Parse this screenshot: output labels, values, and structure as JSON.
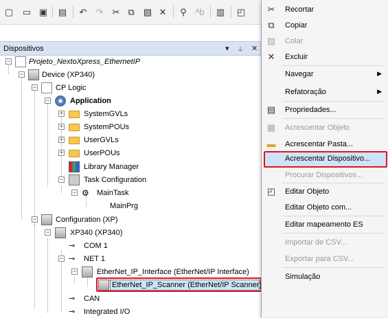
{
  "toolbar": {
    "icons": [
      "new-file-icon",
      "open-folder-icon",
      "save-icon",
      "print-icon",
      "undo-icon",
      "redo-icon",
      "cut-icon",
      "copy-icon",
      "paste-icon",
      "delete-icon",
      "find-icon",
      "replace-icon",
      "properties-icon",
      "new-object-icon"
    ]
  },
  "panel": {
    "title": "Dispositivos",
    "controls": [
      "▾",
      "📌",
      "✕"
    ]
  },
  "tree": {
    "items": [
      {
        "label": "Projeto_NextoXpress_EthernetIP",
        "italic": true
      },
      {
        "label": "Device (XP340)"
      },
      {
        "label": "CP Logic"
      },
      {
        "label": "Application",
        "bold": true
      },
      {
        "label": "SystemGVLs"
      },
      {
        "label": "SystemPOUs"
      },
      {
        "label": "UserGVLs"
      },
      {
        "label": "UserPOUs"
      },
      {
        "label": "Library Manager"
      },
      {
        "label": "Task Configuration"
      },
      {
        "label": "MainTask"
      },
      {
        "label": "MainPrg"
      },
      {
        "label": "Configuration (XP)"
      },
      {
        "label": "XP340 (XP340)"
      },
      {
        "label": "COM 1"
      },
      {
        "label": "NET 1"
      },
      {
        "label": "EtherNet_IP_Interface (EtherNet/IP Interface)"
      },
      {
        "label": "EtherNet_IP_Scanner (EtherNet/IP Scanner)"
      },
      {
        "label": "CAN"
      },
      {
        "label": "Integrated I/O"
      }
    ]
  },
  "menu": {
    "items": [
      {
        "label": "Recortar",
        "icon": "cut-icon",
        "glyph": "✂"
      },
      {
        "label": "Copiar",
        "icon": "copy-icon",
        "glyph": "⧉"
      },
      {
        "label": "Colar",
        "icon": "paste-icon",
        "glyph": "📋",
        "disabled": true
      },
      {
        "label": "Excluir",
        "icon": "delete-icon",
        "glyph": "✕"
      },
      {
        "label": "Navegar",
        "submenu": true
      },
      {
        "label": "Refatoração",
        "submenu": true
      },
      {
        "label": "Propriedades...",
        "icon": "properties-icon",
        "glyph": "▤"
      },
      {
        "label": "Acrescentar Objeto",
        "icon": "add-object-icon",
        "glyph": "▦",
        "disabled": true
      },
      {
        "label": "Acrescentar Pasta...",
        "icon": "folder-icon",
        "glyph": "▬"
      },
      {
        "label": "Acrescentar Dispositivo...",
        "highlight": true
      },
      {
        "label": "Procurar Dispositivos...",
        "disabled": true
      },
      {
        "label": "Editar Objeto",
        "icon": "edit-object-icon",
        "glyph": "◰"
      },
      {
        "label": "Editar Objeto com..."
      },
      {
        "label": "Editar mapeamento ES"
      },
      {
        "label": "Importar de CSV...",
        "disabled": true
      },
      {
        "label": "Exportar para CSV...",
        "disabled": true
      },
      {
        "label": "Simulação"
      }
    ]
  },
  "colors": {
    "highlight_border": "#e0141e",
    "selection": "#cde3f7",
    "panel_header": "#d9e4f2"
  }
}
